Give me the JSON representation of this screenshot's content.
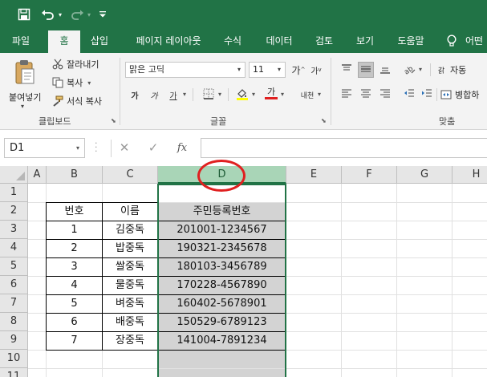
{
  "qat": {
    "save_icon": "save-icon",
    "undo_icon": "undo-icon",
    "redo_icon": "redo-icon",
    "customize_icon": "customize-qat-icon"
  },
  "tabs": [
    {
      "label": "파일",
      "active": false
    },
    {
      "label": "홈",
      "active": true
    },
    {
      "label": "삽입",
      "active": false
    },
    {
      "label": "페이지 레이아웃",
      "active": false
    },
    {
      "label": "수식",
      "active": false
    },
    {
      "label": "데이터",
      "active": false
    },
    {
      "label": "검토",
      "active": false
    },
    {
      "label": "보기",
      "active": false
    },
    {
      "label": "도움말",
      "active": false
    },
    {
      "label": "어떤",
      "active": false
    }
  ],
  "ribbon": {
    "clipboard": {
      "paste_label": "붙여넣기",
      "cut_label": "잘라내기",
      "copy_label": "복사",
      "format_painter_label": "서식 복사",
      "group_label": "클립보드"
    },
    "font": {
      "font_name": "맑은 고딕",
      "font_size": "11",
      "grow_label": "가",
      "shrink_label": "가",
      "bold_label": "가",
      "italic_label": "가",
      "underline_label": "가",
      "font_color_label": "가",
      "phonetic_label": "내천",
      "group_label": "글꼴"
    },
    "alignment": {
      "wrap_label": "자동",
      "merge_label": "병합하",
      "group_label": "맞춤"
    }
  },
  "formula_bar": {
    "name_box": "D1",
    "fx_label": "fx",
    "formula": ""
  },
  "sheet": {
    "columns": [
      "A",
      "B",
      "C",
      "D",
      "E",
      "F",
      "G",
      "H"
    ],
    "selected_column": "D",
    "rows": [
      "1",
      "2",
      "3",
      "4",
      "5",
      "6",
      "7",
      "8",
      "9",
      "10",
      "11"
    ],
    "table": {
      "headers": [
        "번호",
        "이름",
        "주민등록번호"
      ],
      "rows": [
        [
          "1",
          "김중독",
          "201001-1234567"
        ],
        [
          "2",
          "밥중독",
          "190321-2345678"
        ],
        [
          "3",
          "쌀중독",
          "180103-3456789"
        ],
        [
          "4",
          "물중독",
          "170228-4567890"
        ],
        [
          "5",
          "벼중독",
          "160402-5678901"
        ],
        [
          "6",
          "배중독",
          "150529-6789123"
        ],
        [
          "7",
          "장중독",
          "141004-7891234"
        ]
      ]
    }
  },
  "colors": {
    "excel_green": "#217346",
    "selected_header": "#a9d5b7",
    "selected_fill": "#d3d3d3",
    "annotation_red": "#e02020"
  }
}
